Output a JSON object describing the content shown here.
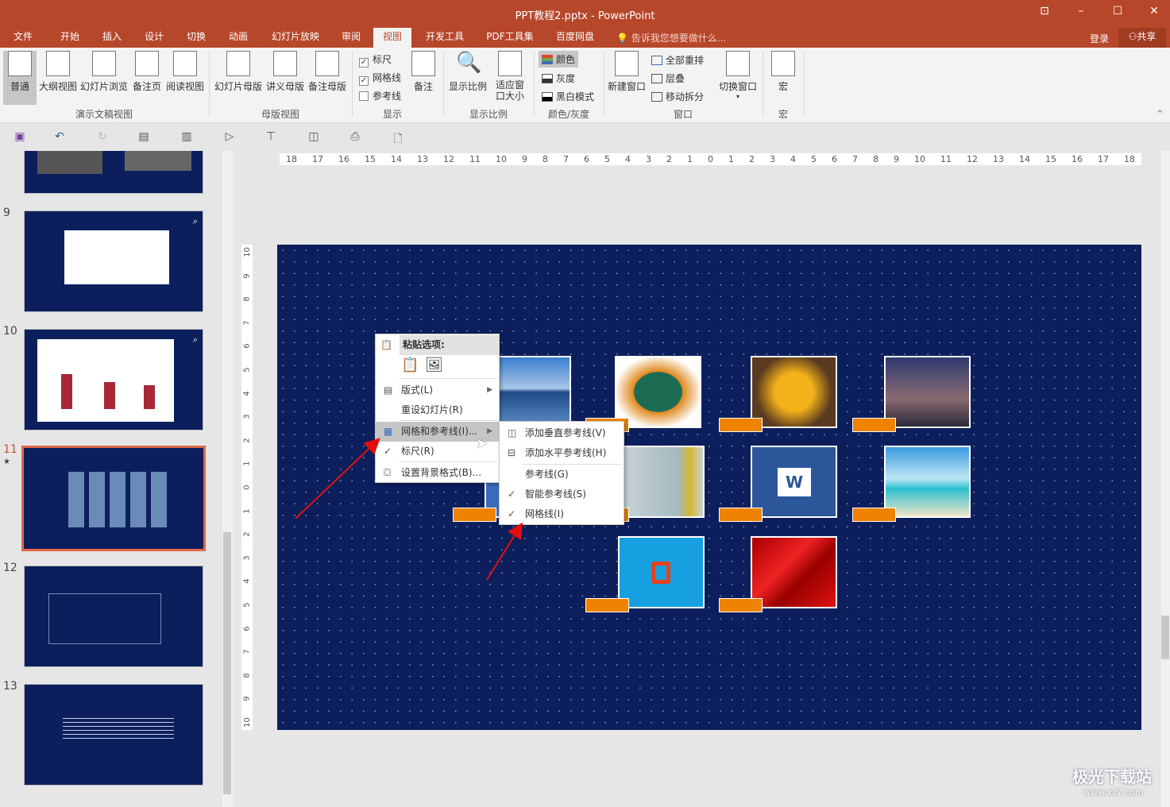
{
  "window": {
    "title": "PPT教程2.pptx - PowerPoint",
    "controls": [
      "⊡",
      "–",
      "☐",
      "✕"
    ]
  },
  "tabs": [
    "文件",
    "开始",
    "插入",
    "设计",
    "切换",
    "动画",
    "幻灯片放映",
    "审阅",
    "视图",
    "开发工具",
    "PDF工具集",
    "百度网盘"
  ],
  "active_tab": "视图",
  "tell_me": "告诉我您想要做什么...",
  "login": "登录",
  "share": "共享",
  "ribbon": {
    "presentation_views": {
      "label": "演示文稿视图",
      "buttons": [
        "普通",
        "大纲视图",
        "幻灯片浏览",
        "备注页",
        "阅读视图"
      ]
    },
    "master_views": {
      "label": "母版视图",
      "buttons": [
        "幻灯片母版",
        "讲义母版",
        "备注母版"
      ]
    },
    "show": {
      "label": "显示",
      "ruler": "标尺",
      "gridlines": "网格线",
      "guides": "参考线",
      "notes": "备注",
      "ruler_checked": true,
      "gridlines_checked": true,
      "guides_checked": false
    },
    "zoom": {
      "label": "显示比例",
      "zoom": "显示比例",
      "fit": "适应窗口大小"
    },
    "color": {
      "label": "颜色/灰度",
      "items": [
        "颜色",
        "灰度",
        "黑白模式"
      ]
    },
    "window": {
      "label": "窗口",
      "new": "新建窗口",
      "arrange": "全部重排",
      "cascade": "层叠",
      "split": "移动拆分",
      "switch": "切换窗口"
    },
    "macros": {
      "label": "宏",
      "button": "宏"
    }
  },
  "slides": {
    "numbers": [
      "9",
      "10",
      "11",
      "12",
      "13"
    ],
    "selected": "11"
  },
  "rulers": {
    "h": [
      "18",
      "17",
      "16",
      "15",
      "14",
      "13",
      "12",
      "11",
      "10",
      "9",
      "8",
      "7",
      "6",
      "5",
      "4",
      "3",
      "2",
      "1",
      "0",
      "1",
      "2",
      "3",
      "4",
      "5",
      "6",
      "7",
      "8",
      "9",
      "10",
      "11",
      "12",
      "13",
      "14",
      "15",
      "16",
      "17",
      "18"
    ],
    "v": [
      "10",
      "9",
      "8",
      "7",
      "6",
      "5",
      "4",
      "3",
      "2",
      "1",
      "0",
      "1",
      "2",
      "3",
      "4",
      "5",
      "6",
      "7",
      "8",
      "9",
      "10"
    ]
  },
  "context_menu": {
    "paste_header": "粘贴选项:",
    "items": [
      "版式(L)",
      "重设幻灯片(R)",
      "网格和参考线(I)...",
      "标尺(R)",
      "设置背景格式(B)..."
    ]
  },
  "submenu": {
    "items": [
      "添加垂直参考线(V)",
      "添加水平参考线(H)",
      "参考线(G)",
      "智能参考线(S)",
      "网格线(I)"
    ]
  },
  "watermark": "极光下载站",
  "watermark_url": "www.xz7.com",
  "colors": {
    "title_bar": "#b7472a",
    "slide_bg": "#0c1f5c",
    "tag": "#ef8200",
    "arrow": "#e01010"
  }
}
